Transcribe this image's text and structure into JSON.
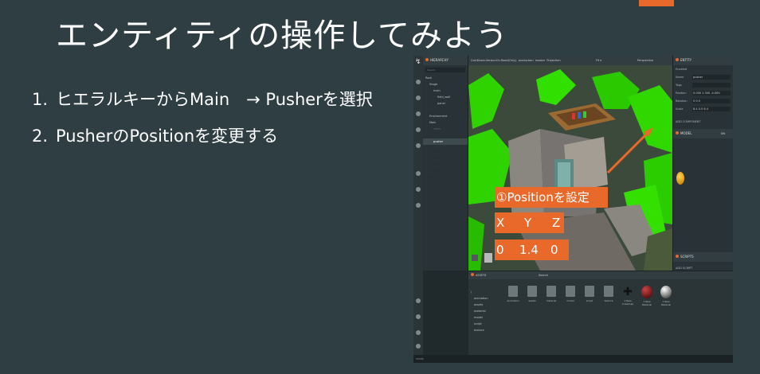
{
  "slide": {
    "title": "エンティティの操作してみよう",
    "steps": [
      {
        "num": "1.",
        "text": "ヒエラルキーからMain　→ Pusherを選択"
      },
      {
        "num": "2.",
        "text": "PusherのPositionを変更する"
      }
    ]
  },
  "overlay": {
    "label": "①Positionを設定",
    "axis_x": "X",
    "axis_y": "Y",
    "axis_z": "Z",
    "value_x": "0",
    "value_y": "1.4",
    "value_z": "0"
  },
  "editor": {
    "hierarchy": {
      "title": "HIERARCHY",
      "search": "Search",
      "items": [
        "Root",
        "Stage",
        "main",
        "field_wall",
        "panel",
        "Environment",
        "Main",
        "coins",
        "",
        "pusher"
      ]
    },
    "viewport": {
      "tabs": [
        "CoinDozer-VersionOn-Road(Only)",
        "production",
        "master",
        "Projection",
        "Perspective"
      ],
      "zoom": "Fit ▾"
    },
    "inspector": {
      "title": "ENTITY",
      "rows": [
        {
          "label": "Enabled",
          "value": ""
        },
        {
          "label": "Name",
          "value": "pusher"
        },
        {
          "label": "Tags",
          "value": ""
        },
        {
          "label": "Position",
          "value": "0.000   1.300   -4.000"
        },
        {
          "label": "Rotation",
          "value": "0   0   0"
        },
        {
          "label": "Scale",
          "value": "8.4   0.5   6.4"
        }
      ],
      "add_component": "ADD COMPONENT",
      "model_section": "MODEL",
      "model_on": "ON",
      "scripts_section": "SCRIPTS",
      "add_script": "ADD SCRIPT"
    },
    "assets": {
      "title": "ASSETS",
      "search": "Search",
      "tree": [
        "/",
        "animation",
        "assets",
        "material",
        "model",
        "script",
        "texture"
      ],
      "items": [
        "animation",
        "assets",
        "material",
        "model",
        "script",
        "texture",
        "1 New Cubemap",
        "1 New Material",
        "1 New Material"
      ]
    },
    "status": "ready"
  },
  "colors": {
    "background": "#2f3e43",
    "accent": "#e8692a",
    "grass": "#2fd400",
    "stone": "#8a8680"
  }
}
